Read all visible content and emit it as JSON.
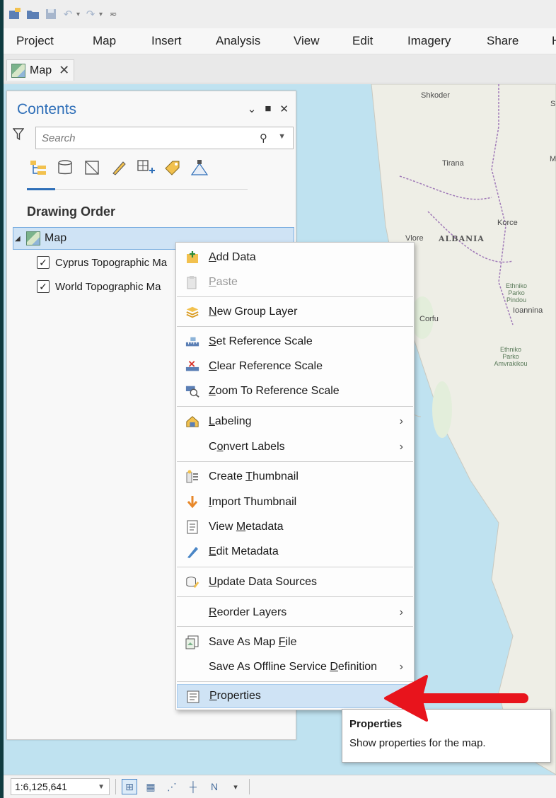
{
  "quick_access": {
    "icons": [
      "new-project-icon",
      "open-project-icon",
      "save-project-icon",
      "undo-icon",
      "redo-icon",
      "customize-icon"
    ]
  },
  "ribbon": {
    "tabs": [
      "Project",
      "Map",
      "Insert",
      "Analysis",
      "View",
      "Edit",
      "Imagery",
      "Share",
      "H"
    ]
  },
  "doc_tab": {
    "label": "Map",
    "close": "✕"
  },
  "map": {
    "places": [
      "Shkoder",
      "Tirana",
      "Korce",
      "Vlore",
      "ALBANIA",
      "Corfu",
      "Ioannina",
      "Ethniko Parko Pindou",
      "Ethniko Parko Amvrakikou",
      "M",
      "S"
    ]
  },
  "contents": {
    "title": "Contents",
    "search_placeholder": "Search",
    "section": "Drawing Order",
    "map_item": "Map",
    "layers": [
      "Cyprus Topographic Ma",
      "World Topographic Ma"
    ]
  },
  "context_menu": {
    "items": [
      {
        "label": "Add Data",
        "icon": "add-data-icon"
      },
      {
        "label": "Paste",
        "icon": "paste-icon",
        "disabled": true
      },
      {
        "label": "New Group Layer",
        "icon": "group-layer-icon"
      },
      {
        "label": "Set Reference Scale",
        "icon": "set-reference-scale-icon"
      },
      {
        "label": "Clear Reference Scale",
        "icon": "clear-reference-scale-icon"
      },
      {
        "label": "Zoom To Reference Scale",
        "icon": "zoom-reference-scale-icon"
      },
      {
        "label": "Labeling",
        "icon": "labeling-icon",
        "submenu": true
      },
      {
        "label": "Convert Labels",
        "submenu": true
      },
      {
        "label": "Create Thumbnail",
        "icon": "create-thumbnail-icon"
      },
      {
        "label": "Import Thumbnail",
        "icon": "import-thumbnail-icon"
      },
      {
        "label": "View Metadata",
        "icon": "view-metadata-icon"
      },
      {
        "label": "Edit Metadata",
        "icon": "edit-metadata-icon"
      },
      {
        "label": "Update Data Sources",
        "icon": "update-data-sources-icon"
      },
      {
        "label": "Reorder Layers",
        "submenu": true
      },
      {
        "label": "Save As Map File",
        "icon": "save-map-file-icon"
      },
      {
        "label": "Save As Offline Service Definition",
        "submenu": true
      },
      {
        "label": "Properties",
        "icon": "properties-icon",
        "highlighted": true
      }
    ]
  },
  "tooltip": {
    "title": "Properties",
    "body": "Show properties for the map."
  },
  "status_bar": {
    "scale": "1:6,125,641"
  },
  "colors": {
    "accent": "#2f6fb8",
    "highlight": "#cfe3f5",
    "annotation_arrow": "#e8141c",
    "water": "#bfe2f0"
  }
}
